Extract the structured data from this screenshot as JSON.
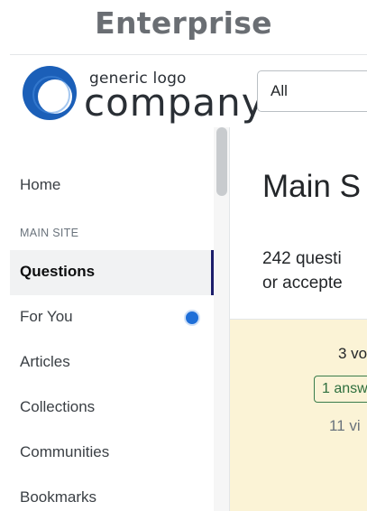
{
  "caption": "Enterprise",
  "logo": {
    "small_text": "generic logo",
    "big_text": "company"
  },
  "search": {
    "scope": "All"
  },
  "sidebar": {
    "home": "Home",
    "section_heading": "MAIN SITE",
    "items": [
      {
        "label": "Questions",
        "active": true
      },
      {
        "label": "For You",
        "indicator": true
      },
      {
        "label": "Articles"
      },
      {
        "label": "Collections"
      },
      {
        "label": "Communities"
      },
      {
        "label": "Bookmarks"
      }
    ]
  },
  "main": {
    "title": "Main S",
    "subtitle_line1": "242 questi",
    "subtitle_line2": "or accepte"
  },
  "question_card": {
    "votes": "3 vo",
    "answers": "1 answ",
    "views": "11 vi"
  },
  "colors": {
    "accent": "#1f6fd8",
    "active_bar": "#1c1e6b",
    "card_background": "#fbf3d6",
    "answer_green": "#2f6f3e"
  }
}
